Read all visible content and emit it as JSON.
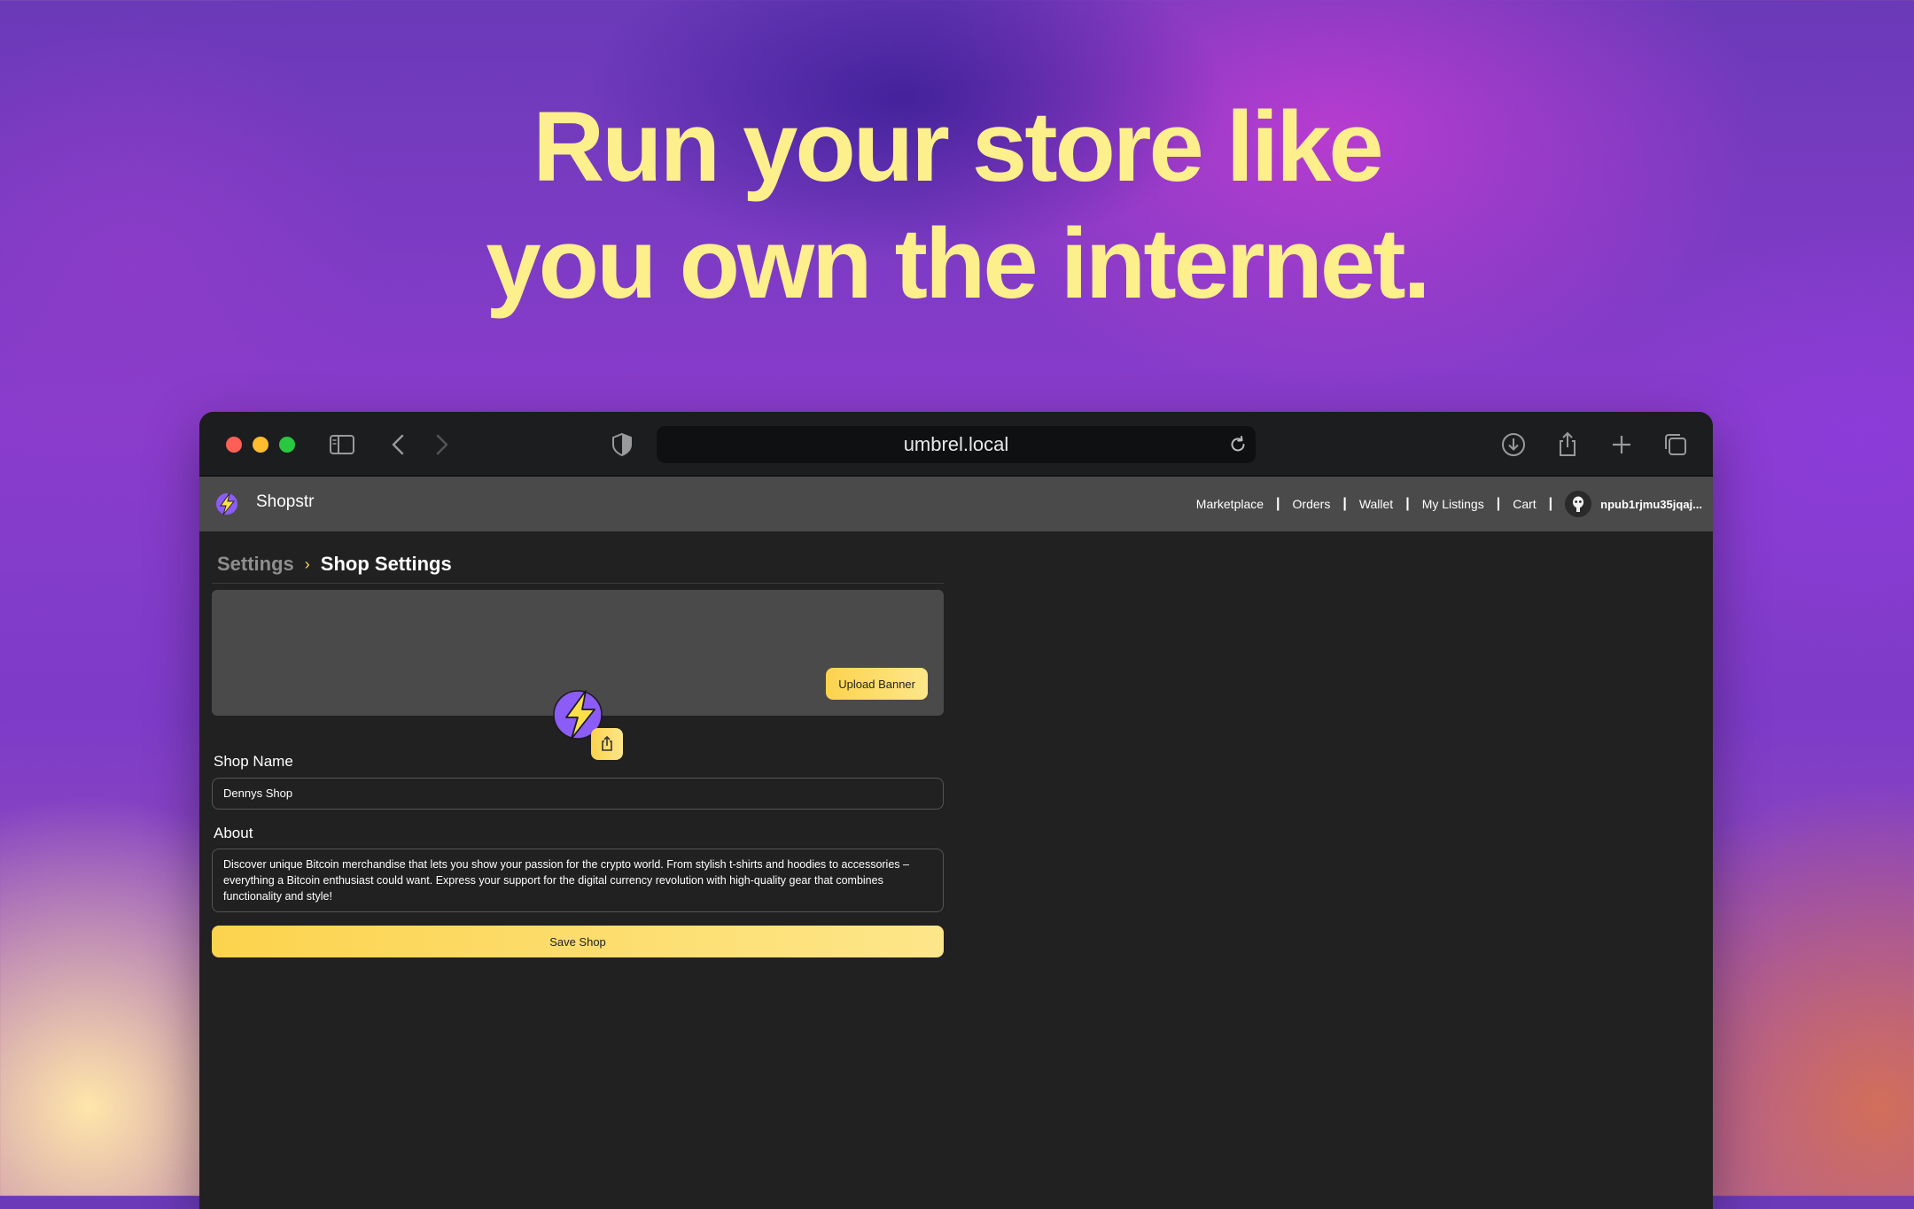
{
  "headline": {
    "line1": "Run your store like",
    "line2": "you own the internet."
  },
  "browser": {
    "url": "umbrel.local"
  },
  "navbar": {
    "brand": "Shopstr",
    "links": [
      "Marketplace",
      "Orders",
      "Wallet",
      "My Listings",
      "Cart"
    ],
    "separator": "|",
    "npub": "npub1rjmu35jqaj..."
  },
  "breadcrumb": {
    "parent": "Settings",
    "current": "Shop Settings"
  },
  "banner": {
    "upload_label": "Upload Banner"
  },
  "form": {
    "shop_name_label": "Shop Name",
    "shop_name_value": "Dennys Shop",
    "about_label": "About",
    "about_value": "Discover unique Bitcoin merchandise that lets you show your passion for the crypto world. From stylish t-shirts and hoodies to accessories – everything a Bitcoin enthusiast could want. Express your support for the digital currency revolution with high-quality gear that combines functionality and style!",
    "save_label": "Save Shop"
  },
  "colors": {
    "accent": "#fcd34d",
    "headline": "#fcef8c",
    "app_background": "#212121",
    "navbar": "#4a4a4a"
  },
  "icons": [
    "sidebar-icon",
    "back-icon",
    "forward-icon",
    "shield-icon",
    "reload-icon",
    "download-icon",
    "share-icon",
    "new-tab-icon",
    "tabs-overview-icon",
    "shopstr-logo-icon",
    "upload-icon",
    "avatar-icon"
  ]
}
